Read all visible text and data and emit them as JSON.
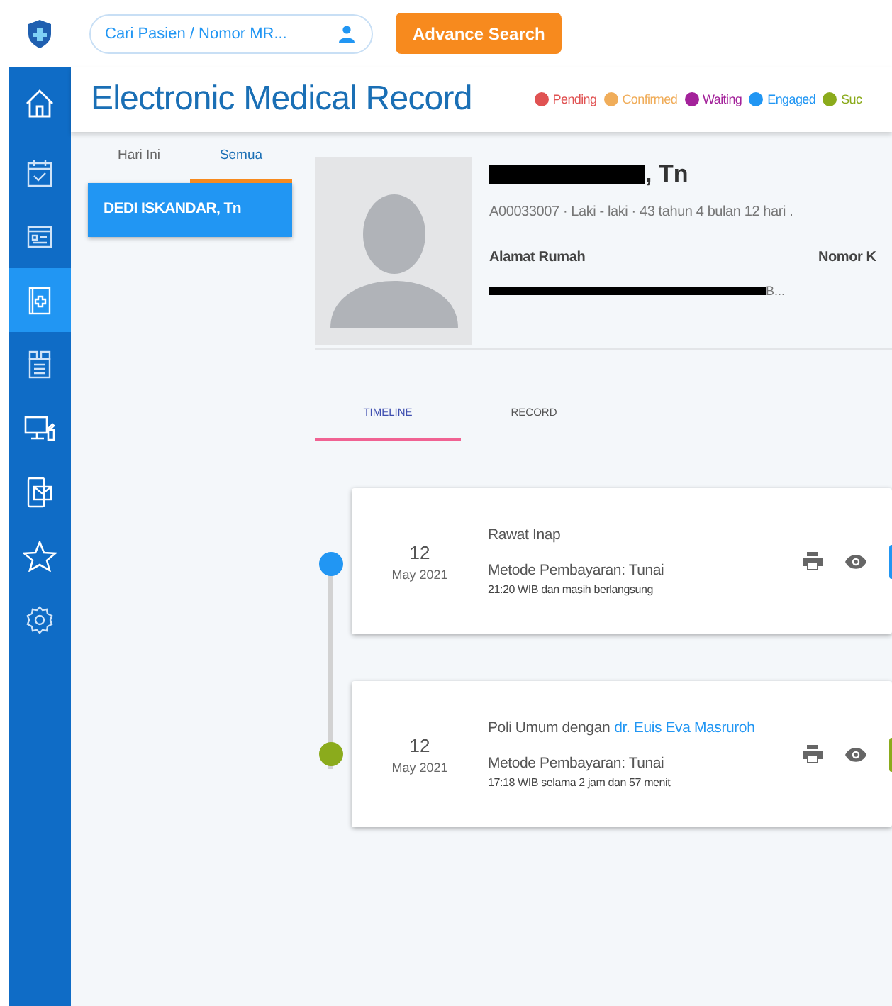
{
  "search": {
    "placeholder": "Cari Pasien / Nomor MR..."
  },
  "advance_search": "Advance Search",
  "title": "Electronic Medical Record",
  "legend": [
    {
      "label": "Pending",
      "color": "#e05252"
    },
    {
      "label": "Confirmed",
      "color": "#f0ad5a"
    },
    {
      "label": "Waiting",
      "color": "#a3229a"
    },
    {
      "label": "Engaged",
      "color": "#2196f3"
    },
    {
      "label": "Suc",
      "color": "#8bab1c"
    }
  ],
  "nav": [
    {
      "selected": false
    },
    {
      "selected": false
    },
    {
      "selected": false
    },
    {
      "selected": true
    },
    {
      "selected": false
    },
    {
      "selected": false
    },
    {
      "selected": false
    },
    {
      "selected": false
    },
    {
      "selected": false
    }
  ],
  "list_tabs": [
    {
      "label": "Hari Ini",
      "selected": false
    },
    {
      "label": "Semua",
      "selected": true
    }
  ],
  "patients": [
    {
      "name": "DEDI ISKANDAR, Tn",
      "selected": true
    }
  ],
  "patient": {
    "name_suffix": ", Tn",
    "info": "A00033007 · Laki - laki · 43 tahun 4 bulan 12 hari .",
    "address_label": "Alamat Rumah",
    "address_tail": "B...",
    "column_2_label": "Nomor K"
  },
  "detail_tabs": [
    {
      "label": "TIMELINE",
      "selected": true
    },
    {
      "label": "RECORD",
      "selected": false
    }
  ],
  "events": [
    {
      "day": "12",
      "month": "May 2021",
      "title": "Rawat Inap",
      "payment": "Metode Pembayaran: Tunai",
      "time": "21:20 WIB dan masih berlangsung",
      "color": "#2196f3"
    },
    {
      "day": "12",
      "month": "May 2021",
      "title": "Poli Umum dengan",
      "doctor": "dr. Euis Eva Masruroh",
      "payment": "Metode Pembayaran: Tunai",
      "time": "17:18 WIB selama 2 jam dan 57 menit",
      "color": "#8bab1c"
    }
  ]
}
